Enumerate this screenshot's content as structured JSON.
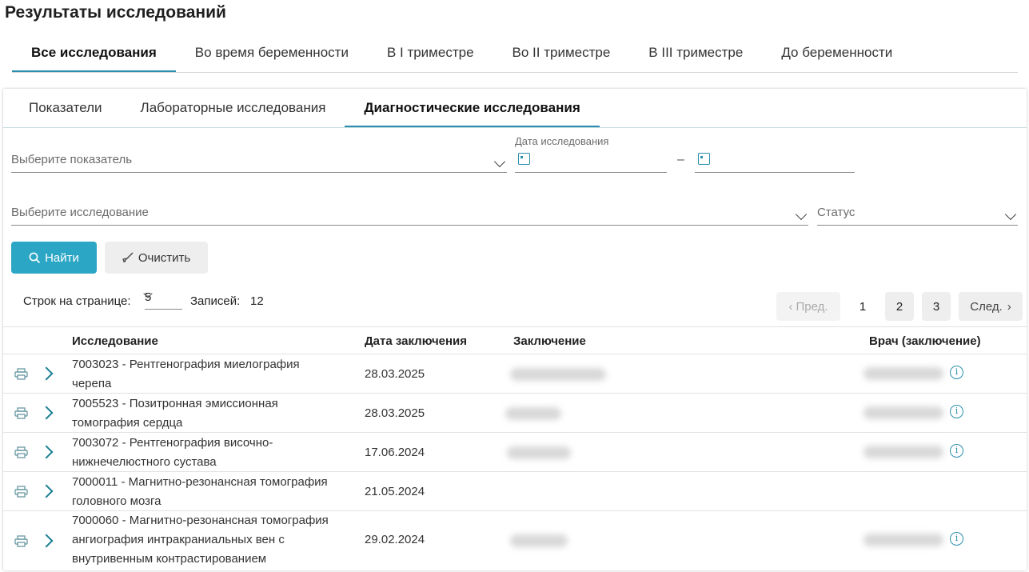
{
  "page": {
    "title": "Результаты исследований"
  },
  "period_tabs": [
    {
      "label": "Все исследования",
      "active": true
    },
    {
      "label": "Во время беременности",
      "active": false
    },
    {
      "label": "В I триместре",
      "active": false
    },
    {
      "label": "Во II триместре",
      "active": false
    },
    {
      "label": "В III триместре",
      "active": false
    },
    {
      "label": "До беременности",
      "active": false
    }
  ],
  "type_tabs": [
    {
      "label": "Показатели",
      "active": false
    },
    {
      "label": "Лабораторные исследования",
      "active": false
    },
    {
      "label": "Диагностические исследования",
      "active": true
    }
  ],
  "filters": {
    "indicator_placeholder": "Выберите показатель",
    "date_label": "Дата исследования",
    "date_from": "",
    "date_separator": "–",
    "date_to": "",
    "study_placeholder": "Выберите исследование",
    "status_placeholder": "Статус"
  },
  "buttons": {
    "find": "Найти",
    "clear": "Очистить"
  },
  "pagination": {
    "rows_label": "Строк на странице:",
    "rows_value": "5",
    "records_label": "Записей:",
    "records_count": "12",
    "prev": "Пред.",
    "next": "След.",
    "pages": [
      "1",
      "2",
      "3"
    ],
    "current_page": "1"
  },
  "table": {
    "headers": {
      "study": "Исследование",
      "date": "Дата заключения",
      "conclusion": "Заключение",
      "doctor": "Врач (заключение)"
    },
    "rows": [
      {
        "study_line1": "7003023 - Рентгенография миелография",
        "study_line2": "черепа",
        "study_line3": "",
        "date": "28.03.2025",
        "has_conclusion": true,
        "has_doctor": true
      },
      {
        "study_line1": "7005523 - Позитронная эмиссионная",
        "study_line2": "томография сердца",
        "study_line3": "",
        "date": "28.03.2025",
        "has_conclusion": true,
        "has_doctor": true
      },
      {
        "study_line1": "7003072 - Рентгенография височно-",
        "study_line2": "нижнечелюстного сустава",
        "study_line3": "",
        "date": "17.06.2024",
        "has_conclusion": true,
        "has_doctor": true
      },
      {
        "study_line1": "7000011 - Магнитно-резонансная томография",
        "study_line2": "головного мозга",
        "study_line3": "",
        "date": "21.05.2024",
        "has_conclusion": false,
        "has_doctor": false
      },
      {
        "study_line1": "7000060 - Магнитно-резонансная томография",
        "study_line2": "ангиография интракраниальных вен с",
        "study_line3": "внутривенным контрастированием",
        "date": "29.02.2024",
        "has_conclusion": true,
        "has_doctor": true
      }
    ]
  },
  "colors": {
    "accent": "#2ba6c5",
    "tab_underline": "#2a8fae",
    "expand_arrow": "#1a7f92"
  },
  "icons": {
    "search": "search-icon",
    "clear": "broom-icon",
    "calendar": "calendar-icon",
    "print": "printer-icon",
    "expand": "chevron-right-icon",
    "info": "info-icon"
  }
}
